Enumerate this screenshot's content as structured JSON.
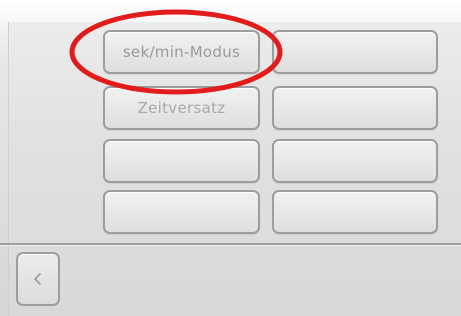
{
  "menu": {
    "left": [
      {
        "label": "sek/min-Modus"
      },
      {
        "label": "Zeitversatz"
      },
      {
        "label": ""
      },
      {
        "label": ""
      }
    ],
    "right": [
      {
        "label": ""
      },
      {
        "label": ""
      },
      {
        "label": ""
      },
      {
        "label": ""
      }
    ]
  },
  "footer": {
    "back_icon": "chevron-left-icon"
  },
  "annotation": {
    "highlight_color": "#e21b1b"
  }
}
